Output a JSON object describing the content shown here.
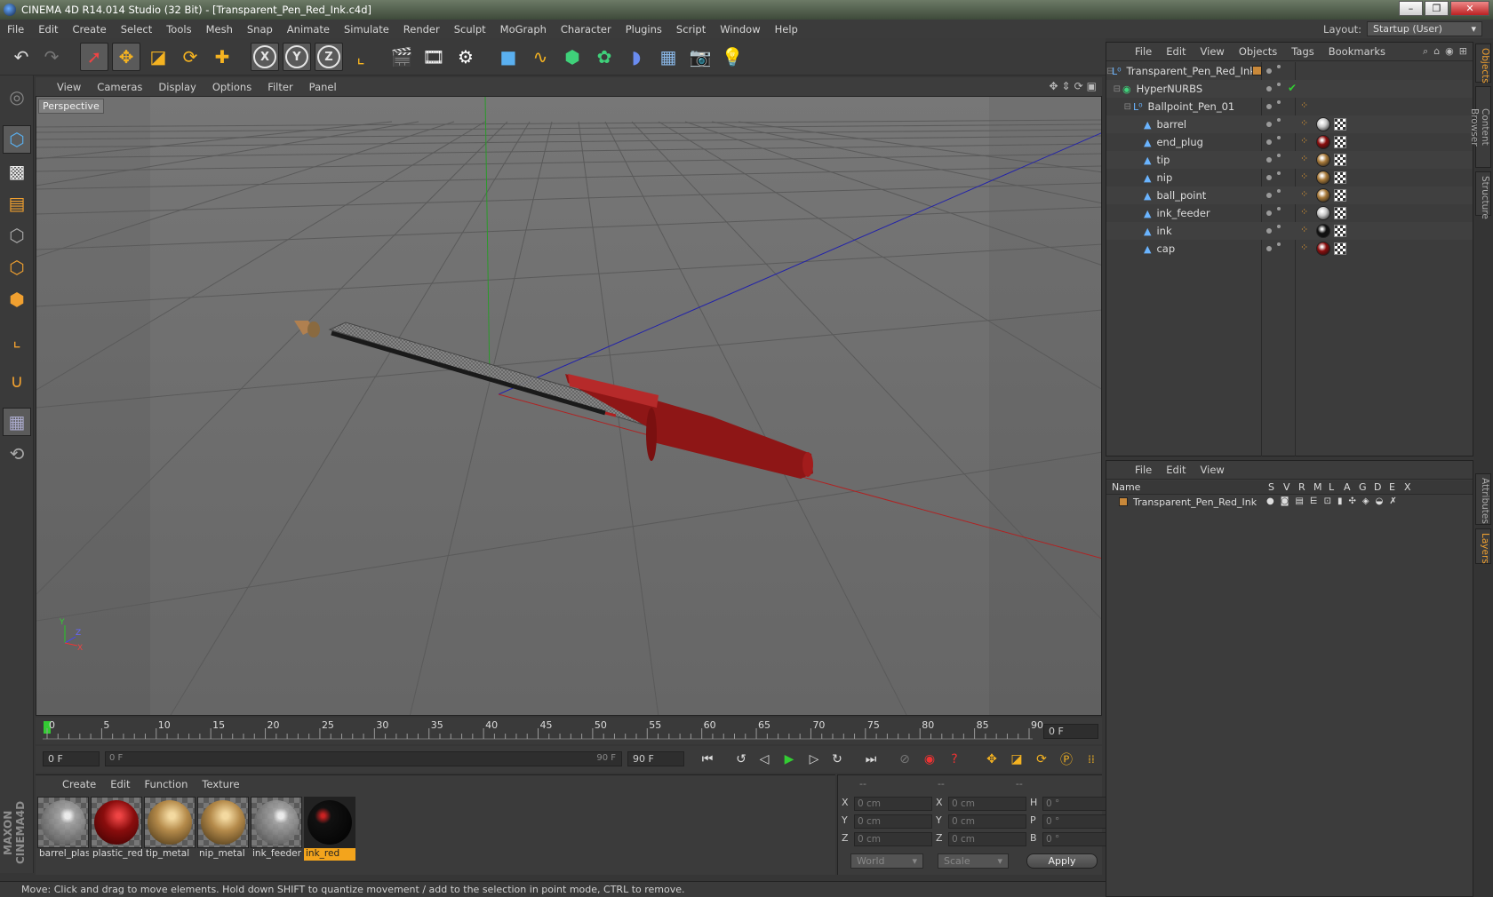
{
  "window": {
    "title": "CINEMA 4D R14.014 Studio (32 Bit) - [Transparent_Pen_Red_Ink.c4d]",
    "minimize": "–",
    "maximize": "❐",
    "close": "✕"
  },
  "menu": [
    "File",
    "Edit",
    "Create",
    "Select",
    "Tools",
    "Mesh",
    "Snap",
    "Animate",
    "Simulate",
    "Render",
    "Sculpt",
    "MoGraph",
    "Character",
    "Plugins",
    "Script",
    "Window",
    "Help"
  ],
  "layout": {
    "label": "Layout:",
    "value": "Startup (User)"
  },
  "viewport": {
    "menu": [
      "View",
      "Cameras",
      "Display",
      "Options",
      "Filter",
      "Panel"
    ],
    "label": "Perspective",
    "axis_x": "X",
    "axis_y": "Y",
    "axis_z": "Z"
  },
  "timeline": {
    "ticks": [
      "0",
      "5",
      "10",
      "15",
      "20",
      "25",
      "30",
      "35",
      "40",
      "45",
      "50",
      "55",
      "60",
      "65",
      "70",
      "75",
      "80",
      "85",
      "90"
    ],
    "current_frame": "0 F",
    "start_field": "0 F",
    "range_start": "0 F",
    "range_end": "90 F",
    "end_field": "90 F"
  },
  "materials": {
    "menu": [
      "Create",
      "Edit",
      "Function",
      "Texture"
    ],
    "items": [
      {
        "name": "barrel_plas",
        "color": "#cfcfcf",
        "selected": false
      },
      {
        "name": "plastic_red",
        "color": "#8a0d0d",
        "selected": false
      },
      {
        "name": "tip_metal",
        "color": "#b48a4a",
        "selected": false
      },
      {
        "name": "nip_metal",
        "color": "#b48a4a",
        "selected": false
      },
      {
        "name": "ink_feeder",
        "color": "#bdbdbd",
        "selected": false
      },
      {
        "name": "ink_red",
        "color": "#111111",
        "selected": true
      }
    ]
  },
  "coords": {
    "headers": [
      "--",
      "--",
      "--"
    ],
    "rows": [
      {
        "a": "X",
        "av": "0 cm",
        "b": "X",
        "bv": "0 cm",
        "c": "H",
        "cv": "0 °"
      },
      {
        "a": "Y",
        "av": "0 cm",
        "b": "Y",
        "bv": "0 cm",
        "c": "P",
        "cv": "0 °"
      },
      {
        "a": "Z",
        "av": "0 cm",
        "b": "Z",
        "bv": "0 cm",
        "c": "B",
        "cv": "0 °"
      }
    ],
    "mode1": "World",
    "mode2": "Scale",
    "apply": "Apply"
  },
  "status": "Move: Click and drag to move elements. Hold down SHIFT to quantize movement / add to the selection in point mode, CTRL to remove.",
  "objects": {
    "menu": [
      "File",
      "Edit",
      "View",
      "Objects",
      "Tags",
      "Bookmarks"
    ],
    "items": [
      {
        "name": "Transparent_Pen_Red_Ink",
        "icon": "null-icon",
        "depth": 0
      },
      {
        "name": "HyperNURBS",
        "icon": "hypernurbs-icon",
        "depth": 1
      },
      {
        "name": "Ballpoint_Pen_01",
        "icon": "null-icon",
        "depth": 2
      },
      {
        "name": "barrel",
        "icon": "polygon-icon",
        "depth": 3,
        "mat": "#c8c8c8"
      },
      {
        "name": "end_plug",
        "icon": "polygon-icon",
        "depth": 3,
        "mat": "#8a0d0d"
      },
      {
        "name": "tip",
        "icon": "polygon-icon",
        "depth": 3,
        "mat": "#a87a3a"
      },
      {
        "name": "nip",
        "icon": "polygon-icon",
        "depth": 3,
        "mat": "#a87a3a"
      },
      {
        "name": "ball_point",
        "icon": "polygon-icon",
        "depth": 3,
        "mat": "#a87a3a"
      },
      {
        "name": "ink_feeder",
        "icon": "polygon-icon",
        "depth": 3,
        "mat": "#c8c8c8"
      },
      {
        "name": "ink",
        "icon": "polygon-icon",
        "depth": 3,
        "mat": "#111111"
      },
      {
        "name": "cap",
        "icon": "polygon-icon",
        "depth": 3,
        "mat": "#8a0d0d"
      }
    ]
  },
  "layers": {
    "menu": [
      "File",
      "Edit",
      "View"
    ],
    "columns": [
      "Name",
      "S",
      "V",
      "R",
      "M",
      "L",
      "A",
      "G",
      "D",
      "E",
      "X"
    ],
    "items": [
      {
        "name": "Transparent_Pen_Red_Ink",
        "color": "#c8883a"
      }
    ]
  },
  "sidetabs": [
    "Objects",
    "Content Browser",
    "Structure",
    "Attributes",
    "Layers"
  ]
}
